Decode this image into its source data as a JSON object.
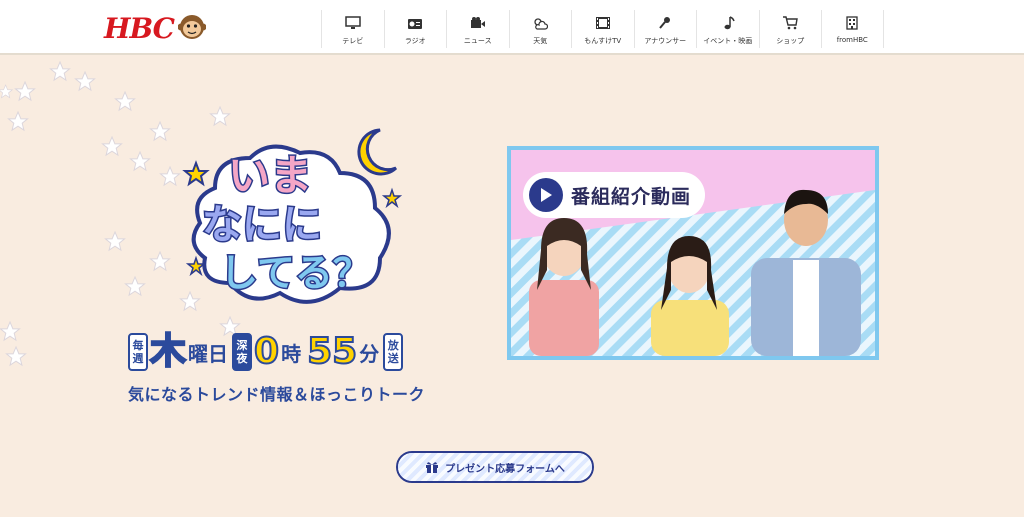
{
  "header": {
    "logo_text": "HBC",
    "nav": [
      {
        "label": "テレビ",
        "icon": "tv-icon"
      },
      {
        "label": "ラジオ",
        "icon": "radio-icon"
      },
      {
        "label": "ニュース",
        "icon": "video-camera-icon"
      },
      {
        "label": "天気",
        "icon": "weather-icon"
      },
      {
        "label": "もんすけTV",
        "icon": "film-icon"
      },
      {
        "label": "アナウンサー",
        "icon": "microphone-icon"
      },
      {
        "label": "イベント・映画",
        "icon": "music-note-icon"
      },
      {
        "label": "ショップ",
        "icon": "cart-icon"
      },
      {
        "label": "fromHBC",
        "icon": "building-icon"
      }
    ]
  },
  "hero": {
    "title_line1": "いま",
    "title_line2": "なにに",
    "title_line3": "してる？",
    "schedule": {
      "day_prefix_1": "毎",
      "day_prefix_2": "週",
      "day": "木",
      "day_suffix": "曜日",
      "time_prefix_1": "深",
      "time_prefix_2": "夜",
      "hour": "0",
      "hour_unit": "時",
      "minute": "55",
      "minute_unit": "分",
      "broadcast_1": "放",
      "broadcast_2": "送"
    },
    "tagline": "気になるトレンド情報＆ほっこりトーク"
  },
  "video": {
    "title": "番組紹介動画"
  },
  "present": {
    "label": "プレゼント応募フォームへ"
  },
  "colors": {
    "brand_red": "#d71920",
    "navy": "#2b3a8c",
    "accent_yellow": "#ffd200",
    "video_border": "#7fc8ef",
    "background": "#f9ece0"
  }
}
